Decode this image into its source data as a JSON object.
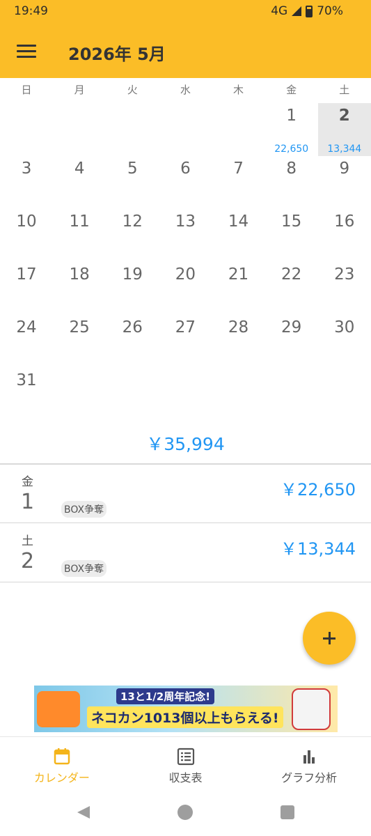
{
  "status_bar": {
    "time": "19:49",
    "network": "4G",
    "battery": "70%"
  },
  "app_bar": {
    "title": "2026年 5月",
    "menu_icon": "hamburger-menu-icon"
  },
  "weekdays": [
    "日",
    "月",
    "火",
    "水",
    "木",
    "金",
    "土"
  ],
  "calendar": {
    "weeks": [
      [
        {
          "day": "",
          "amount": ""
        },
        {
          "day": "",
          "amount": ""
        },
        {
          "day": "",
          "amount": ""
        },
        {
          "day": "",
          "amount": ""
        },
        {
          "day": "",
          "amount": ""
        },
        {
          "day": "1",
          "amount": "22,650"
        },
        {
          "day": "2",
          "amount": "13,344",
          "selected": true
        }
      ],
      [
        {
          "day": "3",
          "amount": ""
        },
        {
          "day": "4",
          "amount": ""
        },
        {
          "day": "5",
          "amount": ""
        },
        {
          "day": "6",
          "amount": ""
        },
        {
          "day": "7",
          "amount": ""
        },
        {
          "day": "8",
          "amount": ""
        },
        {
          "day": "9",
          "amount": ""
        }
      ],
      [
        {
          "day": "10",
          "amount": ""
        },
        {
          "day": "11",
          "amount": ""
        },
        {
          "day": "12",
          "amount": ""
        },
        {
          "day": "13",
          "amount": ""
        },
        {
          "day": "14",
          "amount": ""
        },
        {
          "day": "15",
          "amount": ""
        },
        {
          "day": "16",
          "amount": ""
        }
      ],
      [
        {
          "day": "17",
          "amount": ""
        },
        {
          "day": "18",
          "amount": ""
        },
        {
          "day": "19",
          "amount": ""
        },
        {
          "day": "20",
          "amount": ""
        },
        {
          "day": "21",
          "amount": ""
        },
        {
          "day": "22",
          "amount": ""
        },
        {
          "day": "23",
          "amount": ""
        }
      ],
      [
        {
          "day": "24",
          "amount": ""
        },
        {
          "day": "25",
          "amount": ""
        },
        {
          "day": "26",
          "amount": ""
        },
        {
          "day": "27",
          "amount": ""
        },
        {
          "day": "28",
          "amount": ""
        },
        {
          "day": "29",
          "amount": ""
        },
        {
          "day": "30",
          "amount": ""
        }
      ],
      [
        {
          "day": "31",
          "amount": ""
        },
        {
          "day": "",
          "amount": ""
        },
        {
          "day": "",
          "amount": ""
        },
        {
          "day": "",
          "amount": ""
        },
        {
          "day": "",
          "amount": ""
        },
        {
          "day": "",
          "amount": ""
        },
        {
          "day": "",
          "amount": ""
        }
      ]
    ],
    "month_total": "￥35,994"
  },
  "entries": [
    {
      "weekday": "金",
      "day": "1",
      "tag": "BOX争奪",
      "amount": "￥22,650"
    },
    {
      "weekday": "土",
      "day": "2",
      "tag": "BOX争奪",
      "amount": "￥13,344"
    }
  ],
  "fab": {
    "icon": "plus-icon"
  },
  "ad": {
    "line1": "13と1/2周年記念!",
    "line2": "ネコカン1013個以上もらえる!"
  },
  "bottom_nav": [
    {
      "label": "カレンダー",
      "icon": "calendar-icon",
      "active": true
    },
    {
      "label": "収支表",
      "icon": "list-table-icon",
      "active": false
    },
    {
      "label": "グラフ分析",
      "icon": "bar-chart-icon",
      "active": false
    }
  ],
  "colors": {
    "primary": "#fbbd27",
    "amount": "#2196f3",
    "active_nav": "#f4b41a"
  }
}
